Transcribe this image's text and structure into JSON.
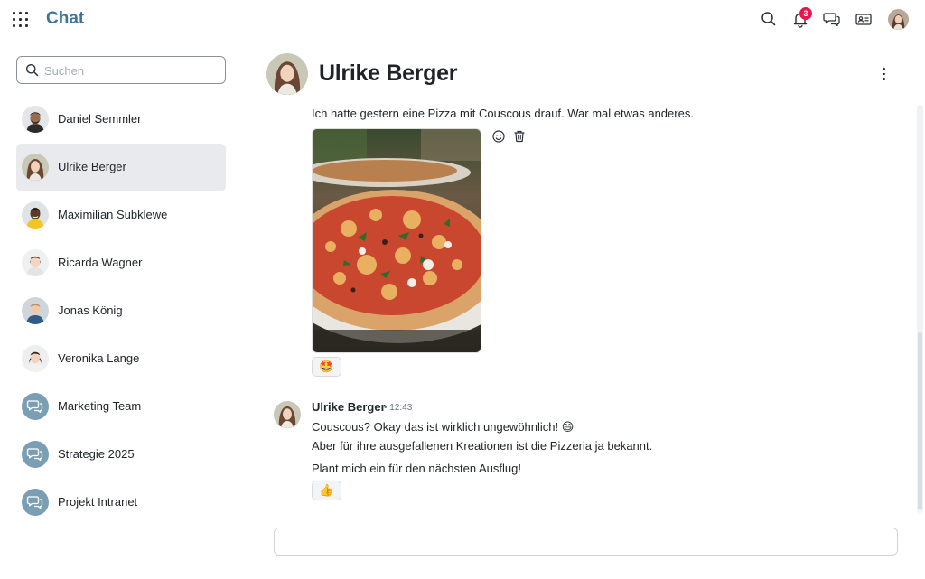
{
  "app": {
    "title": "Chat"
  },
  "topbar": {
    "notification_count": "3"
  },
  "search": {
    "placeholder": "Suchen",
    "value": ""
  },
  "contacts": [
    {
      "name": "Daniel Semmler",
      "type": "person",
      "active": false
    },
    {
      "name": "Ulrike Berger",
      "type": "person",
      "active": true
    },
    {
      "name": "Maximilian Subklewe",
      "type": "person",
      "active": false
    },
    {
      "name": "Ricarda Wagner",
      "type": "person",
      "active": false
    },
    {
      "name": "Jonas König",
      "type": "person",
      "active": false
    },
    {
      "name": "Veronika Lange",
      "type": "person",
      "active": false
    },
    {
      "name": "Marketing Team",
      "type": "group",
      "active": false
    },
    {
      "name": "Strategie 2025",
      "type": "group",
      "active": false
    },
    {
      "name": "Projekt Intranet",
      "type": "group",
      "active": false
    }
  ],
  "conversation": {
    "title": "Ulrike Berger",
    "messages": [
      {
        "text": "Ich hatte gestern eine Pizza mit Couscous drauf. War mal etwas anderes.",
        "image": "pizza-photo",
        "reaction": "🤩"
      },
      {
        "sender": "Ulrike Berger",
        "time": "• 12:43",
        "lines": [
          "Couscous? Okay das ist wirklich ungewöhnlich! 😄",
          "Aber für ihre ausgefallenen Kreationen ist die Pizzeria ja bekannt.",
          "Plant mich ein für den nächsten Ausflug!"
        ],
        "reaction": "👍"
      }
    ]
  },
  "composer": {
    "placeholder": "",
    "value": ""
  },
  "colors": {
    "brand": "#3e7596",
    "badge": "#e5184e",
    "active_item": "#e8eaee",
    "group_avatar": "#7a9fb4"
  },
  "icons": [
    "apps-grid-icon",
    "search-icon",
    "bell-icon",
    "chat-bubbles-icon",
    "contact-card-icon",
    "emoji-icon",
    "trash-icon",
    "more-vertical-icon"
  ]
}
